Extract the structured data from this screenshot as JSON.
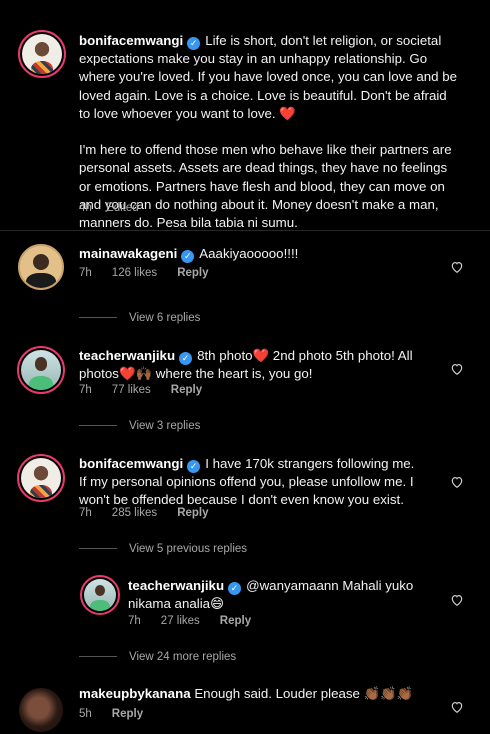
{
  "caption": {
    "username": "bonifacemwangi",
    "text_p1": "Life is short, don't let religion, or societal expectations make you stay in an unhappy relationship. Go where you're loved. If you have loved once, you can love and be loved again. Love is a choice. Love is beautiful. Don't be afraid to love whoever you want to love.",
    "heart": "❤️",
    "text_p2": "I'm here to offend those men who behave like their partners are personal assets. Assets are dead things, they have no feelings or emotions. Partners have flesh and blood, they can move on and you can do nothing about it. Money doesn't make a man, manners do. Pesa bila tabia ni sumu.",
    "time": "4h",
    "separator": "·",
    "edited": "Edited"
  },
  "comments": [
    {
      "username": "mainawakageni",
      "text": "Aaakiyaooooo!!!!",
      "time": "7h",
      "likes": "126 likes",
      "reply": "Reply",
      "view_replies": "View 6 replies"
    },
    {
      "username": "teacherwanjiku",
      "text_a": "8th photo",
      "text_b": " 2nd photo 5th photo! All photos",
      "text_c": " where the heart is, you go!",
      "heart": "❤️",
      "hands": "🙌🏾",
      "time": "7h",
      "likes": "77 likes",
      "reply": "Reply",
      "view_replies": "View 3 replies"
    },
    {
      "username": "bonifacemwangi",
      "text": "I have 170k strangers following me. If my personal opinions offend you, please unfollow me. I won't be offended because I don't even know you exist.",
      "time": "7h",
      "likes": "285 likes",
      "reply": "Reply",
      "view_replies": "View 5 previous replies"
    },
    {
      "username": "teacherwanjiku",
      "text": "@wanyamaann Mahali yuko nikama analia",
      "emoji": "😄",
      "time": "7h",
      "likes": "27 likes",
      "reply": "Reply",
      "view_replies": "View 24 more replies"
    },
    {
      "username": "makeupbykanana",
      "text": "Enough said. Louder please",
      "emoji": "👏🏾👏🏾👏🏾",
      "time": "5h",
      "reply": "Reply"
    }
  ],
  "verified_mark": "✓",
  "icons": {
    "verified": "verified-badge-icon",
    "like": "heart-outline-icon"
  },
  "colors": {
    "background": "#000000",
    "text": "#f2f2f2",
    "secondary": "#a8a8a8",
    "verified": "#3897f0",
    "heart": "#e0245e",
    "story_ring": "#e83a6d"
  }
}
